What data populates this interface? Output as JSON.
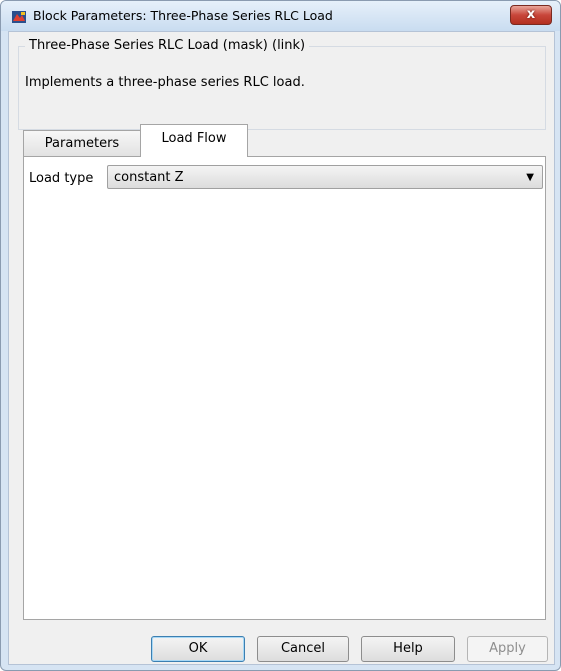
{
  "window": {
    "title": "Block Parameters: Three-Phase Series RLC Load",
    "close_label": "x"
  },
  "description": {
    "group_title": "Three-Phase Series RLC Load (mask) (link)",
    "text": "Implements a three-phase series RLC load."
  },
  "tabs": [
    {
      "label": "Parameters",
      "active": false
    },
    {
      "label": "Load Flow",
      "active": true
    }
  ],
  "load_flow": {
    "load_type_label": "Load type",
    "load_type_value": "constant Z"
  },
  "buttons": {
    "ok": "OK",
    "cancel": "Cancel",
    "help": "Help",
    "apply": "Apply"
  },
  "icons": {
    "app": "simulink-block-icon",
    "close": "close-icon",
    "dropdown": "chevron-down-icon"
  }
}
